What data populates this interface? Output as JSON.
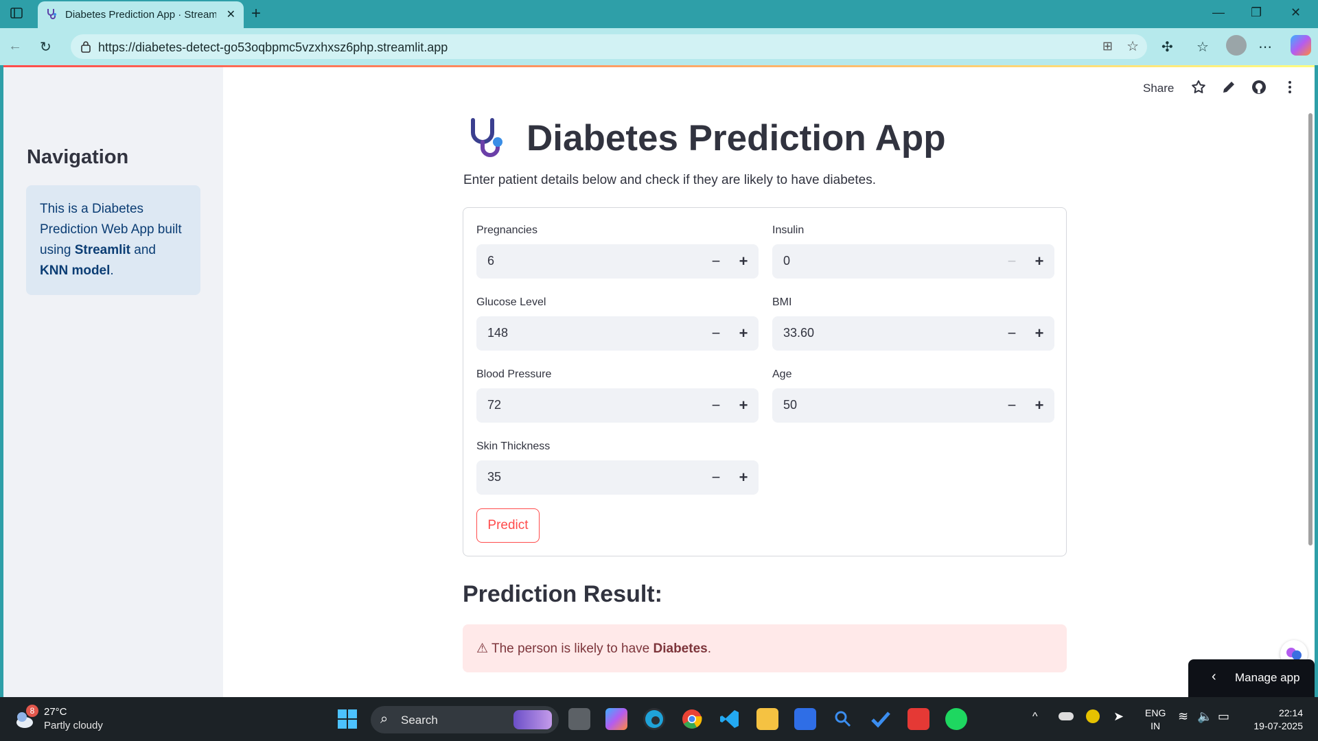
{
  "browser": {
    "tab_title": "Diabetes Prediction App · Streamlit",
    "url": "https://diabetes-detect-go53oqbpmc5vzxhxsz6php.streamlit.app"
  },
  "header": {
    "share_label": "Share"
  },
  "sidebar": {
    "title": "Navigation",
    "info_parts": {
      "p1": "This is a Diabetes Prediction Web App built using ",
      "b1": "Streamlit",
      "p2": " and ",
      "b2": "KNN model",
      "p3": "."
    }
  },
  "main": {
    "title": "Diabetes Prediction App",
    "subtitle": "Enter patient details below and check if they are likely to have diabetes.",
    "fields": {
      "pregnancies": {
        "label": "Pregnancies",
        "value": "6"
      },
      "insulin": {
        "label": "Insulin",
        "value": "0"
      },
      "glucose": {
        "label": "Glucose Level",
        "value": "148"
      },
      "bmi": {
        "label": "BMI",
        "value": "33.60"
      },
      "blood_pressure": {
        "label": "Blood Pressure",
        "value": "72"
      },
      "age": {
        "label": "Age",
        "value": "50"
      },
      "skin_thickness": {
        "label": "Skin Thickness",
        "value": "35"
      }
    },
    "minus_glyph": "−",
    "plus_glyph": "+",
    "predict_label": "Predict",
    "result_heading": "Prediction Result:",
    "result_parts": {
      "icon": "⚠",
      "p1": " The person is likely to have ",
      "b1": "Diabetes",
      "p2": "."
    }
  },
  "manage_app_label": "Manage app",
  "taskbar": {
    "weather_badge": "8",
    "temperature": "27°C",
    "condition": "Partly cloudy",
    "search_label": "Search",
    "lang1": "ENG",
    "lang2": "IN",
    "time": "22:14",
    "date": "19-07-2025"
  },
  "colors": {
    "accent_red": "#ff4b4b",
    "browser_teal": "#2e9fa8",
    "info_blue": "#dde8f3",
    "error_bg": "#ffe9e9"
  }
}
